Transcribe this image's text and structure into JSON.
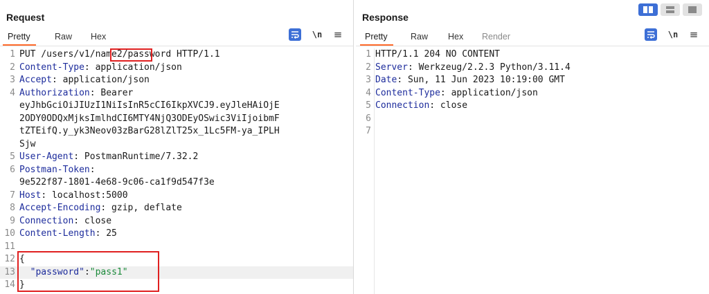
{
  "request": {
    "title": "Request",
    "tabs": [
      {
        "label": "Pretty",
        "active": true
      },
      {
        "label": "Raw"
      },
      {
        "label": "Hex"
      }
    ],
    "newline_label": "\\n",
    "lines": [
      {
        "n": "1",
        "segments": [
          {
            "t": "PUT /users/v1/",
            "c": "plain"
          },
          {
            "t": "name2",
            "c": "plain"
          },
          {
            "t": "/password HTTP/1.1",
            "c": "plain"
          }
        ]
      },
      {
        "n": "2",
        "segments": [
          {
            "t": "Content-Type",
            "c": "k"
          },
          {
            "t": ": application/json",
            "c": "plain"
          }
        ]
      },
      {
        "n": "3",
        "segments": [
          {
            "t": "Accept",
            "c": "k"
          },
          {
            "t": ": application/json",
            "c": "plain"
          }
        ]
      },
      {
        "n": "4",
        "segments": [
          {
            "t": "Authorization",
            "c": "k"
          },
          {
            "t": ": Bearer",
            "c": "plain"
          }
        ]
      },
      {
        "n": "",
        "segments": [
          {
            "t": "eyJhbGciOiJIUzI1NiIsInR5cCI6IkpXVCJ9.eyJleHAiOjE",
            "c": "plain"
          }
        ]
      },
      {
        "n": "",
        "segments": [
          {
            "t": "2ODY0ODQxMjksImlhdCI6MTY4NjQ3ODEyOSwic3ViIjoibmF",
            "c": "plain"
          }
        ]
      },
      {
        "n": "",
        "segments": [
          {
            "t": "tZTEifQ.y_yk3Neov03zBarG28lZlT25x_1Lc5FM-ya_IPLH",
            "c": "plain"
          }
        ]
      },
      {
        "n": "",
        "segments": [
          {
            "t": "Sjw",
            "c": "plain"
          }
        ]
      },
      {
        "n": "5",
        "segments": [
          {
            "t": "User-Agent",
            "c": "k"
          },
          {
            "t": ": PostmanRuntime/7.32.2",
            "c": "plain"
          }
        ]
      },
      {
        "n": "6",
        "segments": [
          {
            "t": "Postman-Token",
            "c": "k"
          },
          {
            "t": ":",
            "c": "plain"
          }
        ]
      },
      {
        "n": "",
        "segments": [
          {
            "t": "9e522f87-1801-4e68-9c06-ca1f9d547f3e",
            "c": "plain"
          }
        ]
      },
      {
        "n": "7",
        "segments": [
          {
            "t": "Host",
            "c": "k"
          },
          {
            "t": ": localhost:5000",
            "c": "plain"
          }
        ]
      },
      {
        "n": "8",
        "segments": [
          {
            "t": "Accept-Encoding",
            "c": "k"
          },
          {
            "t": ": gzip, deflate",
            "c": "plain"
          }
        ]
      },
      {
        "n": "9",
        "segments": [
          {
            "t": "Connection",
            "c": "k"
          },
          {
            "t": ": close",
            "c": "plain"
          }
        ]
      },
      {
        "n": "10",
        "segments": [
          {
            "t": "Content-Length",
            "c": "k"
          },
          {
            "t": ": 25",
            "c": "plain"
          }
        ]
      },
      {
        "n": "11",
        "segments": []
      },
      {
        "n": "12",
        "segments": [
          {
            "t": "{",
            "c": "plain"
          }
        ]
      },
      {
        "n": "13",
        "highlight": true,
        "segments": [
          {
            "t": "  ",
            "c": "plain"
          },
          {
            "t": "\"password\"",
            "c": "jk"
          },
          {
            "t": ":",
            "c": "plain"
          },
          {
            "t": "\"pass1\"",
            "c": "str"
          }
        ]
      },
      {
        "n": "14",
        "segments": [
          {
            "t": "}",
            "c": "plain"
          }
        ]
      }
    ]
  },
  "response": {
    "title": "Response",
    "tabs": [
      {
        "label": "Pretty",
        "active": true
      },
      {
        "label": "Raw"
      },
      {
        "label": "Hex"
      },
      {
        "label": "Render",
        "disabled": true
      }
    ],
    "newline_label": "\\n",
    "lines": [
      {
        "n": "1",
        "segments": [
          {
            "t": "HTTP/1.1 204 NO CONTENT",
            "c": "plain"
          }
        ]
      },
      {
        "n": "2",
        "segments": [
          {
            "t": "Server",
            "c": "k"
          },
          {
            "t": ": Werkzeug/2.2.3 Python/3.11.4",
            "c": "plain"
          }
        ]
      },
      {
        "n": "3",
        "segments": [
          {
            "t": "Date",
            "c": "k"
          },
          {
            "t": ": Sun, 11 Jun 2023 10:19:00 GMT",
            "c": "plain"
          }
        ]
      },
      {
        "n": "4",
        "segments": [
          {
            "t": "Content-Type",
            "c": "k"
          },
          {
            "t": ": application/json",
            "c": "plain"
          }
        ]
      },
      {
        "n": "5",
        "segments": [
          {
            "t": "Connection",
            "c": "k"
          },
          {
            "t": ": close",
            "c": "plain"
          }
        ]
      },
      {
        "n": "6",
        "segments": []
      },
      {
        "n": "7",
        "segments": []
      }
    ]
  },
  "icons": {
    "wrap": "word-wrap-icon",
    "newline": "newline-toggle-icon",
    "menu": "menu-icon",
    "layout": [
      "layout-side-by-side-icon",
      "layout-stacked-icon",
      "layout-single-icon"
    ]
  },
  "colors": {
    "accent": "#ff6a2a",
    "icon_blue": "#3d6fd6",
    "header_key": "#1d2c9c",
    "string": "#1b8a3a",
    "annotation_red": "#e02020"
  }
}
